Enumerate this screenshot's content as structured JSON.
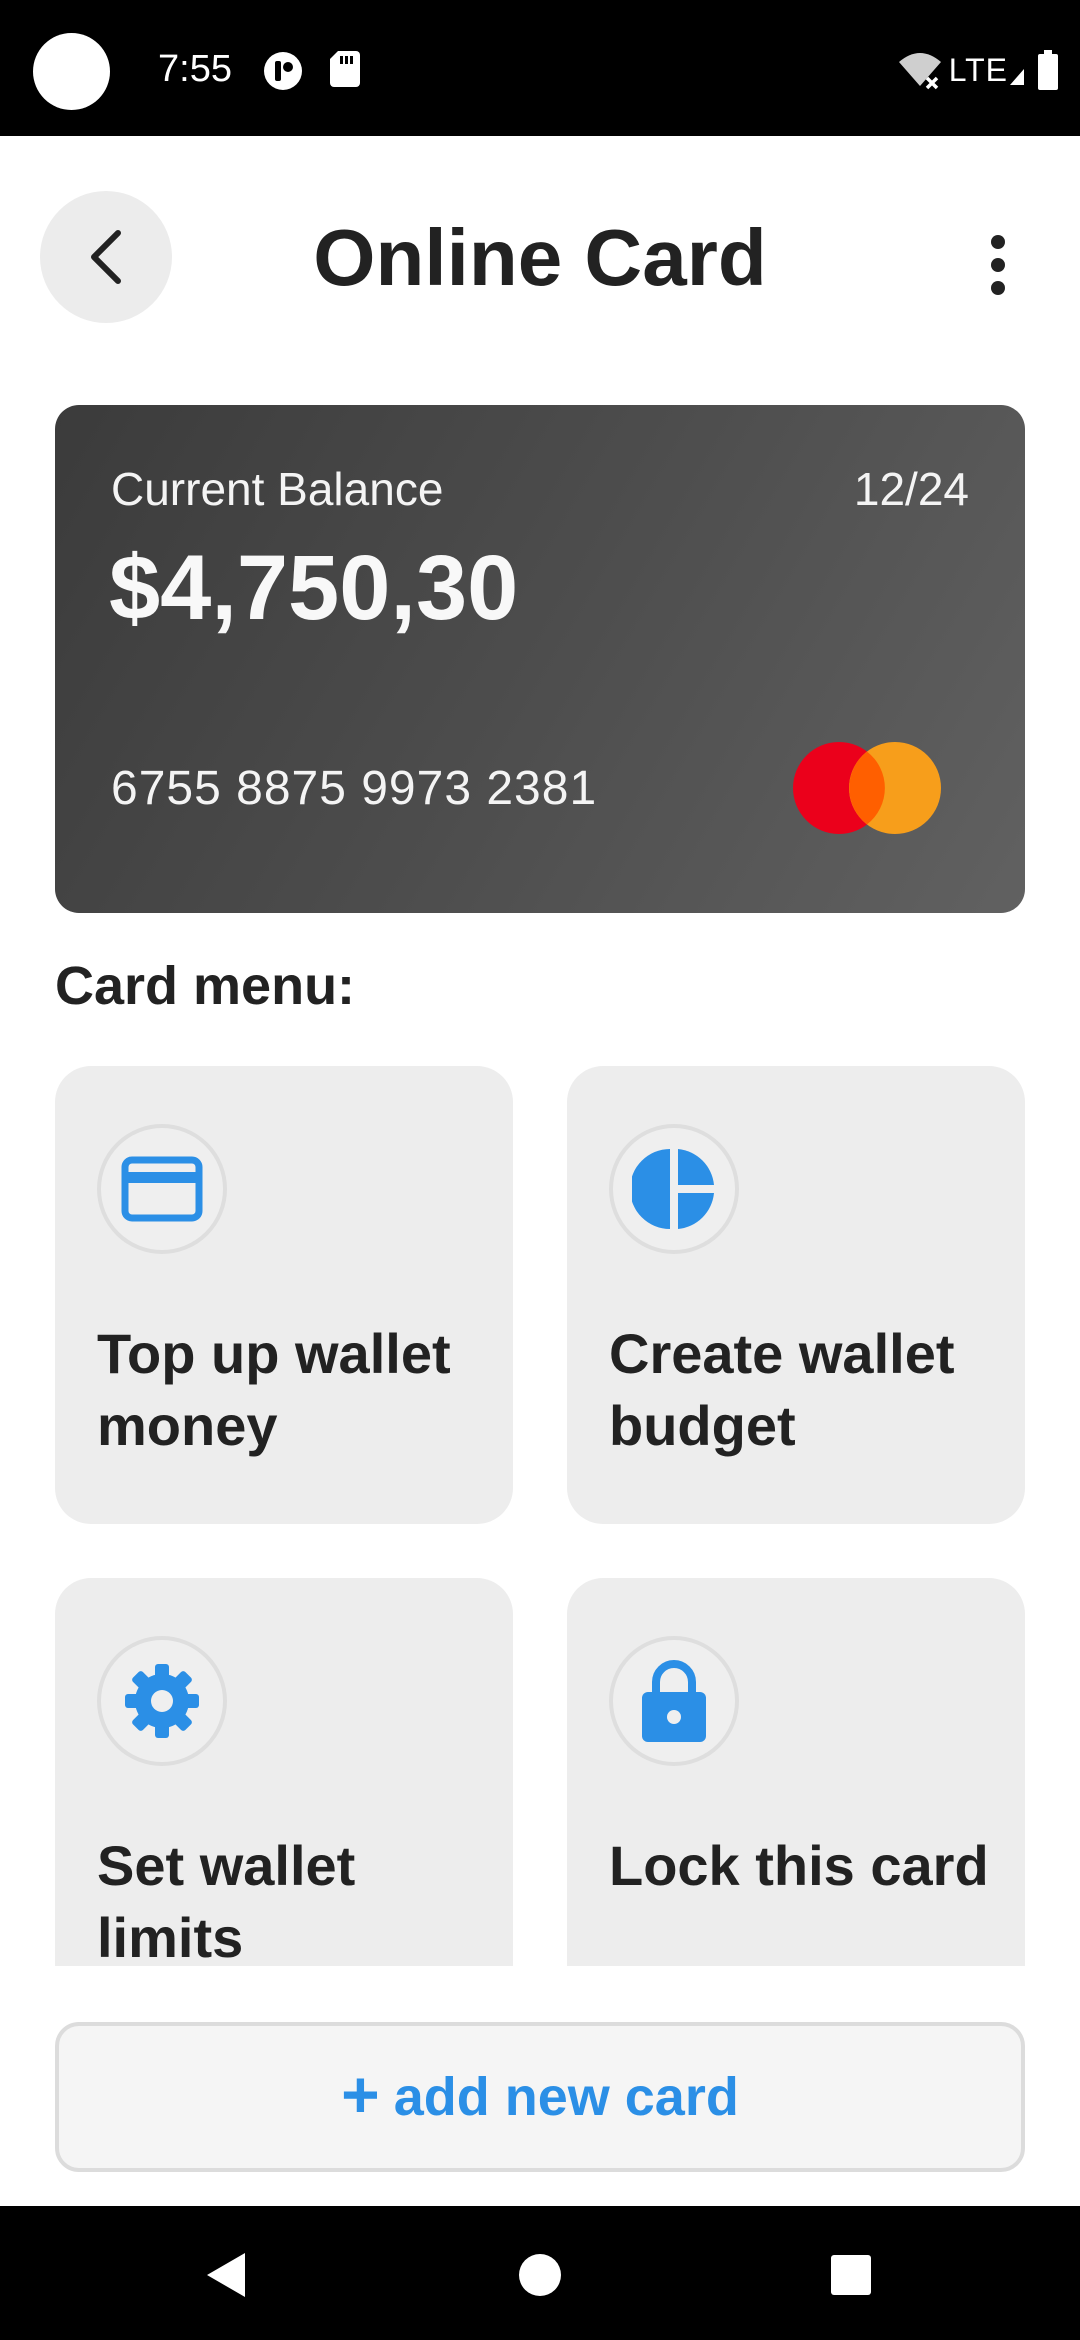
{
  "status_bar": {
    "time": "7:55",
    "network": "LTE",
    "icons": [
      "app-notification-icon",
      "sd-card-icon",
      "wifi-off-icon",
      "signal-icon",
      "battery-icon"
    ]
  },
  "header": {
    "title": "Online Card",
    "back_icon": "chevron-left-icon",
    "more_icon": "more-vertical-icon"
  },
  "card": {
    "balance_label": "Current Balance",
    "balance": "$4,750,30",
    "expiry": "12/24",
    "number": "6755 8875 9973 2381",
    "brand_icon": "mastercard-logo"
  },
  "menu": {
    "title": "Card menu:",
    "items": [
      {
        "label": "Top up wallet money",
        "icon": "credit-card-icon"
      },
      {
        "label": "Create wallet budget",
        "icon": "pie-chart-icon"
      },
      {
        "label": "Set wallet limits",
        "icon": "gear-icon"
      },
      {
        "label": "Lock this card",
        "icon": "lock-icon"
      }
    ]
  },
  "add_card": {
    "plus": "+",
    "label": "add new card"
  },
  "colors": {
    "accent": "#2b8fe6",
    "card_dark": "#3b3b3b",
    "tile_bg": "#ededed",
    "mastercard_red": "#eb001b",
    "mastercard_orange": "#f79e1b"
  },
  "nav_bar": {
    "icons": [
      "nav-back-icon",
      "nav-home-icon",
      "nav-recents-icon"
    ]
  }
}
